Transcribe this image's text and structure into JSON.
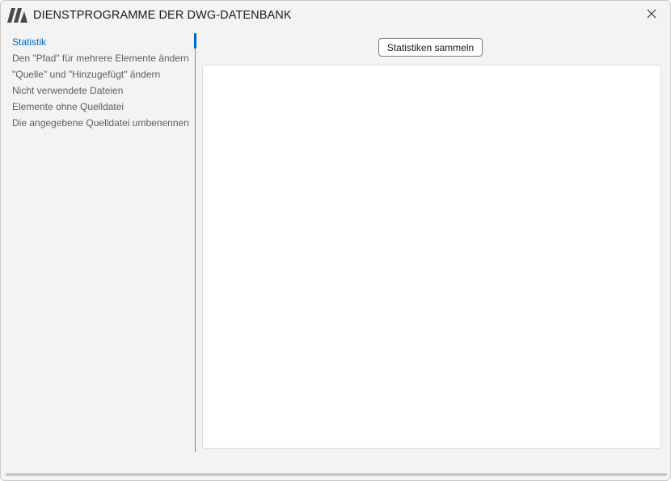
{
  "window": {
    "title": "DIENSTPROGRAMME DER DWG-DATENBANK"
  },
  "sidebar": {
    "items": [
      {
        "label": "Statistik",
        "active": true
      },
      {
        "label": "Den \"Pfad\" für mehrere Elemente ändern",
        "active": false
      },
      {
        "label": "\"Quelle\" und \"Hinzugefügt\" ändern",
        "active": false
      },
      {
        "label": "Nicht verwendete Dateien",
        "active": false
      },
      {
        "label": "Elemente ohne Quelldatei",
        "active": false
      },
      {
        "label": "Die angegebene Quelldatei umbenennen",
        "active": false
      }
    ]
  },
  "main": {
    "collect_button_label": "Statistiken sammeln"
  },
  "colors": {
    "accent": "#0067c0",
    "window_bg": "#f3f3f3",
    "panel_bg": "#ffffff",
    "muted_text": "#5e5e5e"
  },
  "icons": {
    "app": "app-logo-icon",
    "close": "close-icon"
  }
}
